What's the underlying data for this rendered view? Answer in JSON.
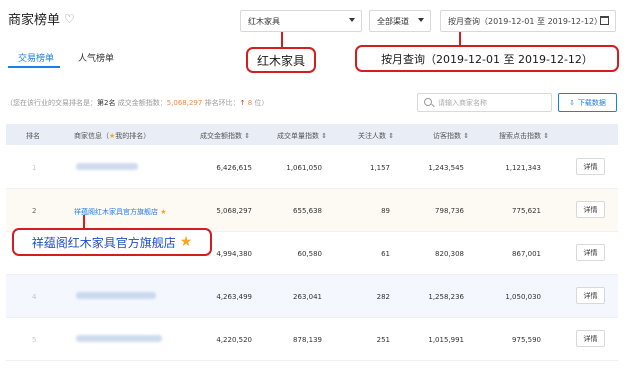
{
  "header": {
    "title": "商家榜单",
    "category_select": "红木家具",
    "channel_select": "全部渠道",
    "date_range": "按月查询（2019-12-01 至 2019-12-12）"
  },
  "tabs": [
    {
      "label": "交易榜单",
      "active": true
    },
    {
      "label": "人气榜单",
      "active": false
    }
  ],
  "callouts": {
    "category": "红木家具",
    "date_range": "按月查询（2019-12-01 至 2019-12-12）",
    "store": "祥蕴阁红木家具官方旗舰店"
  },
  "summary": {
    "prefix": "（您在该行业的交易排名是：",
    "rank": "第2名",
    "amount_label": "成交金额指数：",
    "amount": "5,068,297",
    "change_label": "排名环比：",
    "change_arrow": "↑",
    "change": "8",
    "suffix": "位）"
  },
  "search": {
    "placeholder": "请输入商家名称"
  },
  "download_label": "下载数据",
  "columns": {
    "rank": "排名",
    "merchant": "商家信息（",
    "merchant_star": "★",
    "merchant_suffix": "我的排名）",
    "amount": "成交金额指数",
    "count": "成交单量指数",
    "followers": "关注人数",
    "visitors": "访客指数",
    "clicks": "搜索点击指数",
    "sort_glyph": "⇕"
  },
  "rows": [
    {
      "rank": "1",
      "name": "",
      "amount": "6,426,615",
      "count": "1,061,050",
      "followers": "1,157",
      "visitors": "1,243,545",
      "clicks": "1,121,343",
      "detail": "详情"
    },
    {
      "rank": "2",
      "name": "祥蕴阁红木家具官方旗舰店",
      "amount": "5,068,297",
      "count": "655,638",
      "followers": "89",
      "visitors": "798,736",
      "clicks": "775,621",
      "detail": "详情"
    },
    {
      "rank": "3",
      "name": "",
      "amount": "4,994,380",
      "count": "60,580",
      "followers": "61",
      "visitors": "820,308",
      "clicks": "867,001",
      "detail": "详情"
    },
    {
      "rank": "4",
      "name": "",
      "amount": "4,263,499",
      "count": "263,041",
      "followers": "282",
      "visitors": "1,258,236",
      "clicks": "1,050,030",
      "detail": "详情"
    },
    {
      "rank": "5",
      "name": "",
      "amount": "4,220,520",
      "count": "878,139",
      "followers": "251",
      "visitors": "1,015,991",
      "clicks": "975,590",
      "detail": "详情"
    }
  ],
  "colors": {
    "accent": "#1e7ee8",
    "callout_border": "#d11f1f",
    "star": "#f5a623",
    "highlight_text": "#f0864a",
    "up_arrow": "#e0281f"
  }
}
